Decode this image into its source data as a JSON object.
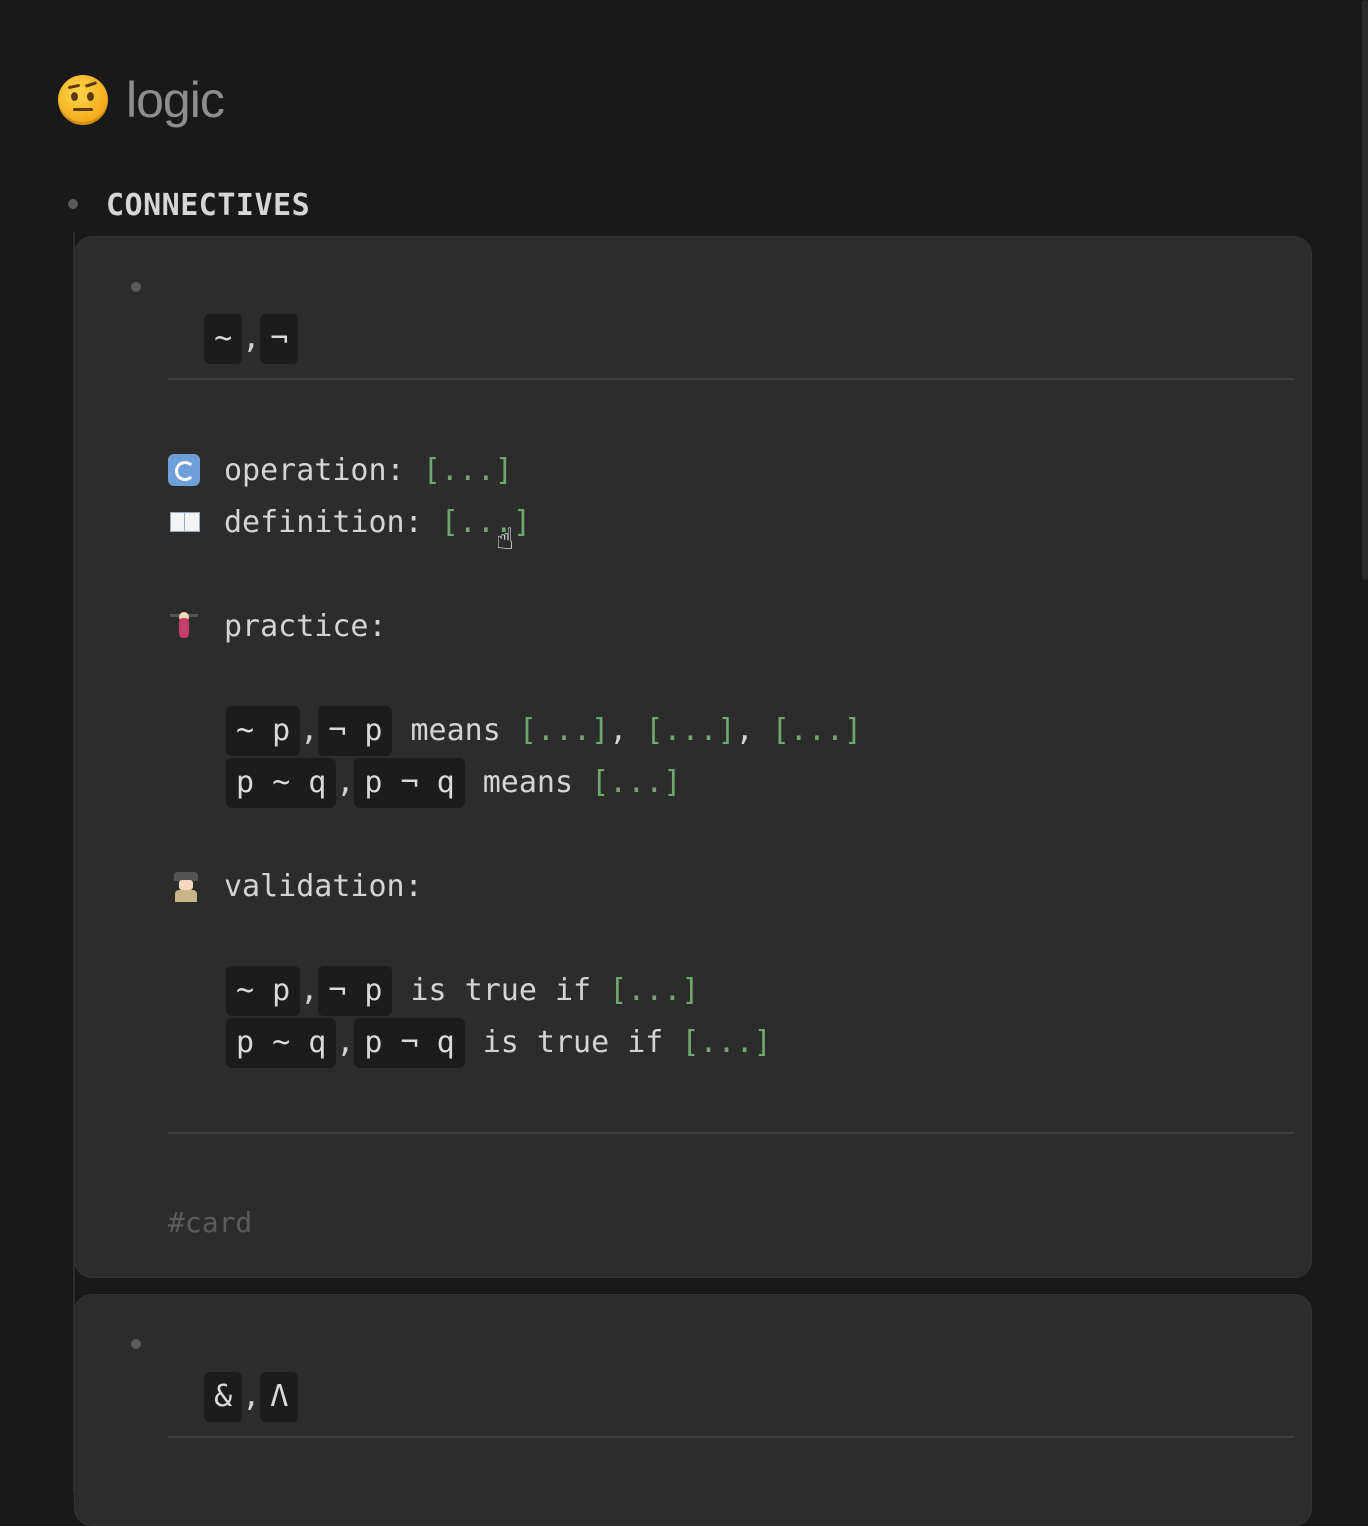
{
  "page": {
    "title": "logic",
    "title_icon": "face-with-raised-eyebrow-icon"
  },
  "section": {
    "label": "CONNECTIVES"
  },
  "cards": [
    {
      "front": {
        "sym1": "~",
        "sep": ",",
        "sym2": "¬"
      },
      "operation": {
        "icon": "arrows-cycle-icon",
        "label": "operation:",
        "cloze": "[...]"
      },
      "definition": {
        "icon": "open-book-icon",
        "label": "definition:",
        "cloze": "[...]"
      },
      "practice": {
        "icon": "weightlifter-icon",
        "label": "practice:",
        "line1": {
          "code1": "~ p",
          "sep": ",",
          "code2": "¬ p",
          "text": "means",
          "cloze1": "[...]",
          "c1": ",",
          "cloze2": "[...]",
          "c2": ",",
          "cloze3": "[...]"
        },
        "line2": {
          "code1": "p ~ q",
          "sep": ",",
          "code2": "p ¬ q",
          "text": "means",
          "cloze1": "[...]"
        }
      },
      "validation": {
        "icon": "detective-icon",
        "label": "validation:",
        "line1": {
          "code1": "~ p",
          "sep": ",",
          "code2": "¬ p",
          "text": "is true if",
          "cloze1": "[...]"
        },
        "line2": {
          "code1": "p ~ q",
          "sep": ",",
          "code2": "p ¬ q",
          "text": "is true if",
          "cloze1": "[...]"
        }
      },
      "tag": "#card"
    },
    {
      "front": {
        "sym1": "&",
        "sep": ",",
        "sym2": "Λ"
      }
    }
  ],
  "colors": {
    "background": "#19191a",
    "card": "#2c2c2c",
    "cloze": "#6fa86d",
    "code_bg": "#1c1c1c"
  }
}
